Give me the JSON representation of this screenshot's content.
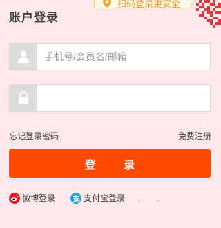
{
  "title": "账户登录",
  "qr_tip": {
    "text": "扫码登录更安全",
    "icon": "location-pin-icon"
  },
  "qr_corner": {
    "icon": "qr-code-icon"
  },
  "username": {
    "placeholder": "手机号/会员名/邮箱",
    "value": "",
    "icon": "user-icon"
  },
  "password": {
    "placeholder": "",
    "value": "",
    "icon": "lock-icon"
  },
  "links": {
    "forgot": "忘记登录密码",
    "register": "免费注册"
  },
  "login_button": "登 录",
  "social": {
    "weibo": {
      "label": "微博登录",
      "icon": "weibo-icon"
    },
    "alipay": {
      "label": "支付宝登录",
      "icon": "alipay-icon"
    }
  },
  "colors": {
    "background": "#fde9ea",
    "accent": "#ff4a00",
    "tip_text": "#e69b2e",
    "qr_red": "#e4393c"
  }
}
